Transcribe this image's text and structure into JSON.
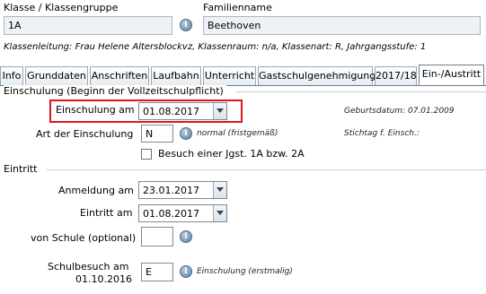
{
  "header": {
    "class_label": "Klasse / Klassengruppe",
    "class_value": "1A",
    "family_label": "Familienname",
    "family_value": "Beethoven",
    "info_line": "Klassenleitung: Frau Helene Altersblockvz, Klassenraum: n/a, Klassenart: R, Jahrgangsstufe: 1"
  },
  "tabs": [
    {
      "label": "Info"
    },
    {
      "label": "Grunddaten"
    },
    {
      "label": "Anschriften"
    },
    {
      "label": "Laufbahn"
    },
    {
      "label": "Unterricht"
    },
    {
      "label": "Gastschulgenehmigung"
    },
    {
      "label": "2017/18"
    },
    {
      "label": "Ein-/Austritt",
      "active": true
    }
  ],
  "einschulung": {
    "section_title": "Einschulung (Beginn der Vollzeitschulpflicht)",
    "date_label": "Einschulung am",
    "date_value": "01.08.2017",
    "birth_label": "Geburtsdatum: 07.01.2009",
    "art_label": "Art der Einschulung",
    "art_value": "N",
    "art_note": "normal (fristgemäß)",
    "stichtag_label": "Stichtag f. Einsch.:",
    "checkbox_label": "Besuch einer Jgst. 1A bzw. 2A",
    "checkbox_checked": false,
    "highlight_color": "#e0161b"
  },
  "eintritt": {
    "section_title": "Eintritt",
    "anmeldung_label": "Anmeldung am",
    "anmeldung_value": "23.01.2017",
    "eintritt_label": "Eintritt am",
    "eintritt_value": "01.08.2017",
    "von_schule_label": "von Schule (optional)",
    "von_schule_value": "",
    "schulbesuch_label_1": "Schulbesuch am",
    "schulbesuch_label_2": "01.10.2016",
    "schulbesuch_value": "E",
    "schulbesuch_note": "Einschulung (erstmalig)"
  },
  "icons": {
    "info": "info-icon",
    "dropdown": "chevron-down-icon",
    "info_glyph": "i"
  }
}
